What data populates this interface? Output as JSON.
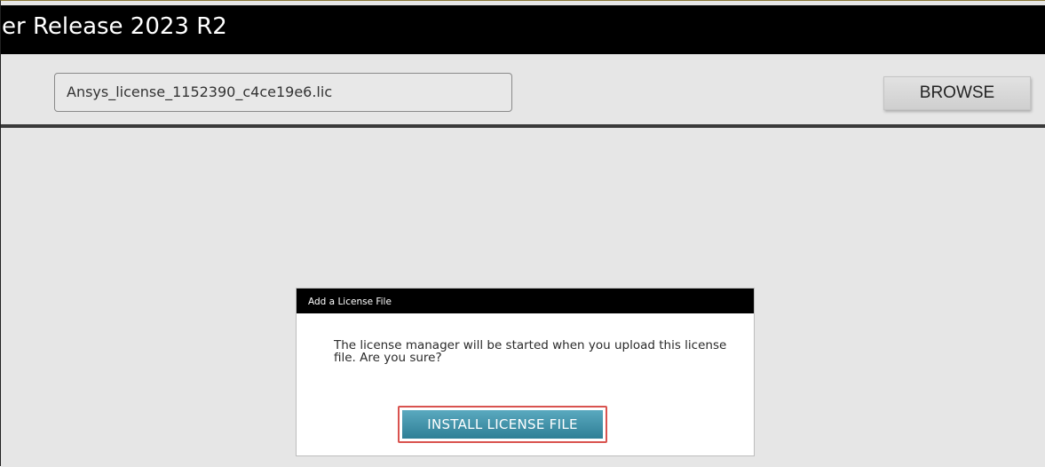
{
  "window": {
    "title": "er Release 2023 R2"
  },
  "file_row": {
    "file_value": "Ansys_license_1152390_c4ce19e6.lic",
    "browse_label": "BROWSE"
  },
  "dialog": {
    "title": "Add a License File",
    "message": "The license manager will be started when you upload this license file. Are you sure?",
    "install_label": "INSTALL LICENSE FILE"
  },
  "colors": {
    "title_bar": "#000000",
    "background": "#e6e6e6",
    "install_button": "#3a8fa6",
    "highlight_border": "#d9534f"
  }
}
